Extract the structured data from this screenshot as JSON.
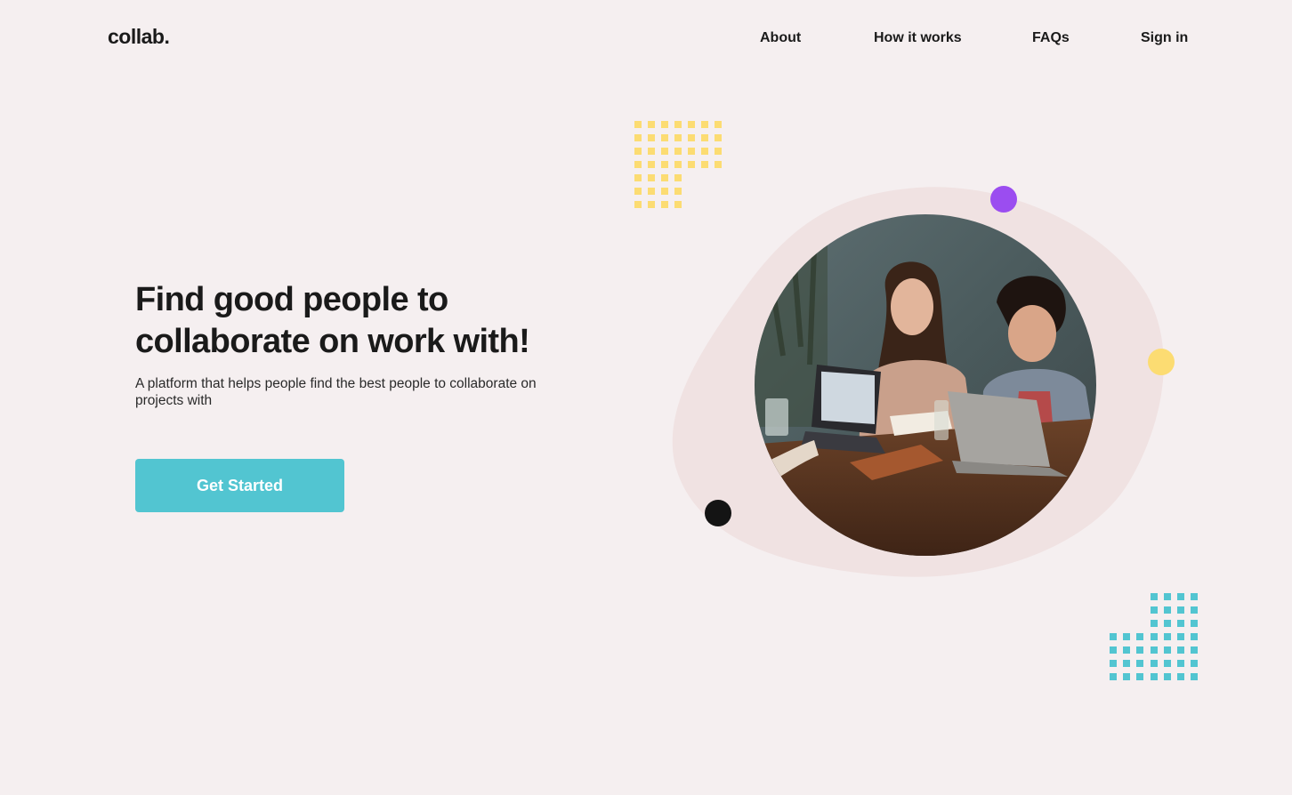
{
  "nav": {
    "logo": "collab.",
    "links": [
      "About",
      "How it works",
      "FAQs",
      "Sign in"
    ]
  },
  "hero": {
    "title": "Find good people to collaborate on work with!",
    "subtitle": "A platform that helps people find the best people to collaborate on projects with",
    "cta_label": "Get Started"
  },
  "colors": {
    "background": "#f5eff0",
    "accent": "#52c5d1",
    "blob": "#f0e2e2",
    "yellow": "#fcdc72",
    "purple": "#9b4df0",
    "black": "#141414"
  },
  "image": {
    "subject": "two people laughing at a table with laptops"
  }
}
